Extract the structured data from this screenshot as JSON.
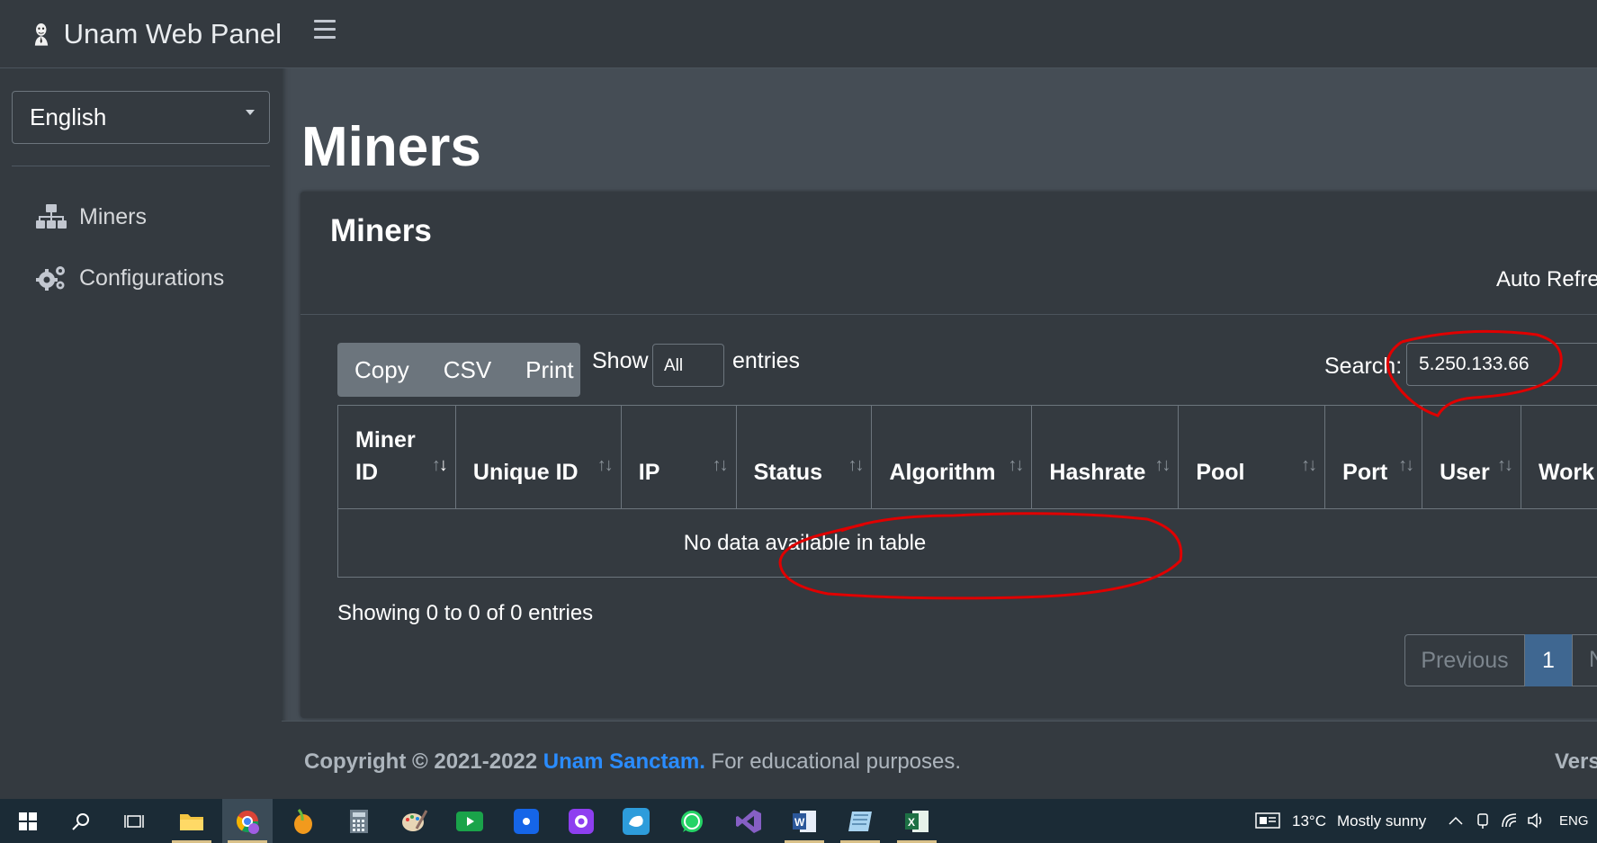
{
  "sidebar": {
    "brand": "Unam Web Panel",
    "language": "English",
    "items": [
      {
        "label": "Miners"
      },
      {
        "label": "Configurations"
      }
    ]
  },
  "page": {
    "title": "Miners"
  },
  "card": {
    "title": "Miners",
    "auto_refresh": "Auto Refre"
  },
  "toolbar": {
    "copy": "Copy",
    "csv": "CSV",
    "print": "Print",
    "show": "Show",
    "length_value": "All",
    "entries": "entries",
    "search_label": "Search:",
    "search_value": "5.250.133.66"
  },
  "table": {
    "columns": [
      {
        "line1": "Miner",
        "line2": "ID"
      },
      {
        "line1": "",
        "line2": "Unique ID"
      },
      {
        "line1": "",
        "line2": "IP"
      },
      {
        "line1": "",
        "line2": "Status"
      },
      {
        "line1": "",
        "line2": "Algorithm"
      },
      {
        "line1": "",
        "line2": "Hashrate"
      },
      {
        "line1": "",
        "line2": "Pool"
      },
      {
        "line1": "",
        "line2": "Port"
      },
      {
        "line1": "",
        "line2": "User"
      },
      {
        "line1": "",
        "line2": "Work"
      }
    ],
    "empty_message": "No data available in table"
  },
  "info": "Showing 0 to 0 of 0 entries",
  "pagination": {
    "previous": "Previous",
    "current": "1",
    "next": "N"
  },
  "footer": {
    "copyright": "Copyright © 2021-2022",
    "link": "Unam Sanctam.",
    "suffix": "For educational purposes.",
    "version": "Vers"
  },
  "taskbar": {
    "weather": "13°C",
    "weather_desc": "Mostly sunny",
    "lang": "ENG"
  },
  "colors": {
    "sidebar": "#343a40",
    "content": "#454d55",
    "accent": "#2a8cff",
    "page_active": "#3f6791",
    "annotation": "#e00000"
  }
}
